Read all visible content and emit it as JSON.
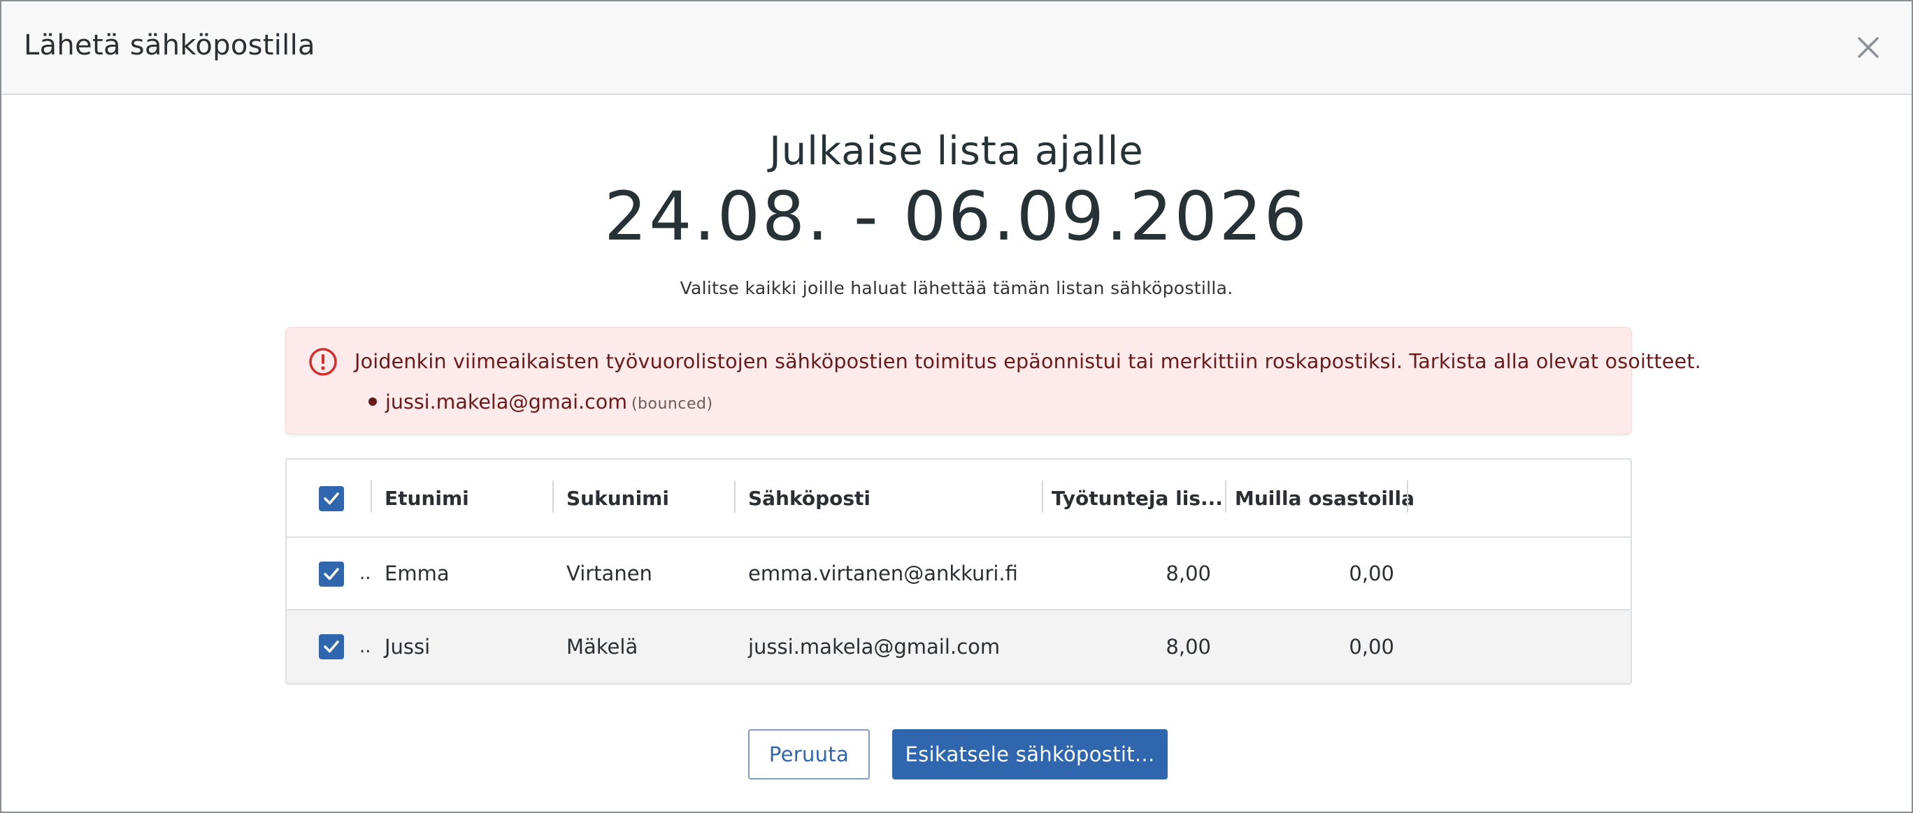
{
  "dialog": {
    "title": "Lähetä sähköpostilla",
    "close_icon": "close-icon"
  },
  "heading": {
    "title": "Julkaise lista ajalle",
    "date_range": "24.08. - 06.09.2026",
    "instruction": "Valitse kaikki joille haluat lähettää tämän listan sähköpostilla."
  },
  "alert": {
    "icon": "alert-circle-icon",
    "message": "Joidenkin viimeaikaisten työvuorolistojen sähköpostien toimitus epäonnistui tai merkittiin roskapostiksi. Tarkista alla olevat osoitteet.",
    "items": [
      {
        "email": "jussi.makela@gmai.com",
        "status": "(bounced)"
      }
    ],
    "colors": {
      "background": "#fcebea",
      "text": "#6a1a1a",
      "icon": "#d32f2f"
    }
  },
  "table": {
    "select_all_checked": true,
    "columns": [
      "Etunimi",
      "Sukunimi",
      "Sähköposti",
      "Työtunteja lis...",
      "Muilla osastoilla"
    ],
    "rows": [
      {
        "checked": true,
        "marker": "..",
        "first": "Emma",
        "last": "Virtanen",
        "email": "emma.virtanen@ankkuri.fi",
        "hours": "8,00",
        "other": "0,00"
      },
      {
        "checked": true,
        "marker": "..",
        "first": "Jussi",
        "last": "Mäkelä",
        "email": "jussi.makela@gmail.com",
        "hours": "8,00",
        "other": "0,00"
      }
    ]
  },
  "actions": {
    "cancel_label": "Peruuta",
    "preview_label": "Esikatsele sähköpostit..."
  },
  "colors": {
    "accent": "#2f66ad"
  }
}
